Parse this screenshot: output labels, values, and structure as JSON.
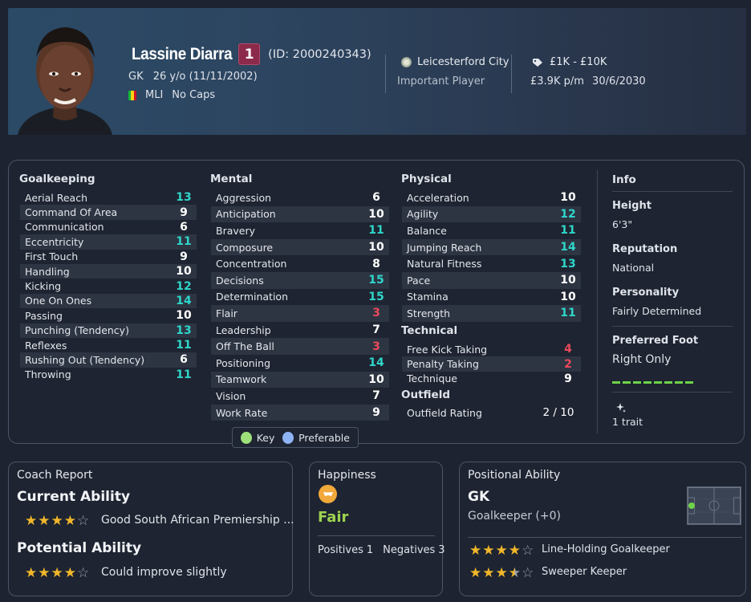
{
  "header": {
    "name": "Lassine Diarra",
    "squad_number": "1",
    "player_id": "(ID: 2000240343)",
    "position": "GK",
    "age_dob": "26 y/o (11/11/2002)",
    "nation": "MLI",
    "caps": "No Caps",
    "club": "Leicesterford City",
    "squad_role": "Important Player",
    "value": "£1K - £10K",
    "wage": "£3.9K p/m",
    "contract_end": "30/6/2030"
  },
  "sections": {
    "goalkeeping": {
      "title": "Goalkeeping",
      "attrs": [
        {
          "name": "Aerial Reach",
          "value": "13",
          "color": "cyan"
        },
        {
          "name": "Command Of Area",
          "value": "9",
          "color": "white"
        },
        {
          "name": "Communication",
          "value": "6",
          "color": "white"
        },
        {
          "name": "Eccentricity",
          "value": "11",
          "color": "cyan"
        },
        {
          "name": "First Touch",
          "value": "9",
          "color": "white"
        },
        {
          "name": "Handling",
          "value": "10",
          "color": "white"
        },
        {
          "name": "Kicking",
          "value": "12",
          "color": "cyan"
        },
        {
          "name": "One On Ones",
          "value": "14",
          "color": "cyan"
        },
        {
          "name": "Passing",
          "value": "10",
          "color": "white"
        },
        {
          "name": "Punching (Tendency)",
          "value": "13",
          "color": "cyan"
        },
        {
          "name": "Reflexes",
          "value": "11",
          "color": "cyan"
        },
        {
          "name": "Rushing Out (Tendency)",
          "value": "6",
          "color": "white"
        },
        {
          "name": "Throwing",
          "value": "11",
          "color": "cyan"
        }
      ]
    },
    "mental": {
      "title": "Mental",
      "attrs": [
        {
          "name": "Aggression",
          "value": "6",
          "color": "white"
        },
        {
          "name": "Anticipation",
          "value": "10",
          "color": "white"
        },
        {
          "name": "Bravery",
          "value": "11",
          "color": "cyan"
        },
        {
          "name": "Composure",
          "value": "10",
          "color": "white"
        },
        {
          "name": "Concentration",
          "value": "8",
          "color": "white"
        },
        {
          "name": "Decisions",
          "value": "15",
          "color": "cyan"
        },
        {
          "name": "Determination",
          "value": "15",
          "color": "cyan"
        },
        {
          "name": "Flair",
          "value": "3",
          "color": "red"
        },
        {
          "name": "Leadership",
          "value": "7",
          "color": "white"
        },
        {
          "name": "Off The Ball",
          "value": "3",
          "color": "red"
        },
        {
          "name": "Positioning",
          "value": "14",
          "color": "cyan"
        },
        {
          "name": "Teamwork",
          "value": "10",
          "color": "white"
        },
        {
          "name": "Vision",
          "value": "7",
          "color": "white"
        },
        {
          "name": "Work Rate",
          "value": "9",
          "color": "white"
        }
      ]
    },
    "physical": {
      "title": "Physical",
      "attrs": [
        {
          "name": "Acceleration",
          "value": "10",
          "color": "white"
        },
        {
          "name": "Agility",
          "value": "12",
          "color": "cyan"
        },
        {
          "name": "Balance",
          "value": "11",
          "color": "cyan"
        },
        {
          "name": "Jumping Reach",
          "value": "14",
          "color": "cyan"
        },
        {
          "name": "Natural Fitness",
          "value": "13",
          "color": "cyan"
        },
        {
          "name": "Pace",
          "value": "10",
          "color": "white"
        },
        {
          "name": "Stamina",
          "value": "10",
          "color": "white"
        },
        {
          "name": "Strength",
          "value": "11",
          "color": "cyan"
        }
      ]
    },
    "technical": {
      "title": "Technical",
      "attrs": [
        {
          "name": "Free Kick Taking",
          "value": "4",
          "color": "red"
        },
        {
          "name": "Penalty Taking",
          "value": "2",
          "color": "red"
        },
        {
          "name": "Technique",
          "value": "9",
          "color": "white"
        }
      ]
    },
    "outfield": {
      "title": "Outfield",
      "attrs": [
        {
          "name": "Outfield Rating",
          "value": "2 / 10",
          "color": "white"
        }
      ]
    }
  },
  "info": {
    "title": "Info",
    "height_label": "Height",
    "height_value": "6'3\"",
    "reputation_label": "Reputation",
    "reputation_value": "National",
    "personality_label": "Personality",
    "personality_value": "Fairly Determined",
    "foot_label": "Preferred Foot",
    "foot_value": "Right Only",
    "traits": "1 trait"
  },
  "legend": {
    "key_label": "Key",
    "key_color": "#9ee07a",
    "preferable_label": "Preferable",
    "preferable_color": "#8fb4f5"
  },
  "coach_report": {
    "title": "Coach Report",
    "current_label": "Current Ability",
    "current_stars": 4,
    "current_text": "Good South African Premiership ...",
    "potential_label": "Potential Ability",
    "potential_stars": 4,
    "potential_text": "Could improve slightly"
  },
  "happiness": {
    "title": "Happiness",
    "status": "Fair",
    "positives_label": "Positives",
    "positives": "1",
    "negatives_label": "Negatives",
    "negatives": "3"
  },
  "positional": {
    "title": "Positional Ability",
    "position": "GK",
    "role_full": "Goalkeeper (+0)",
    "roles": [
      {
        "name": "Line-Holding Goalkeeper",
        "stars": 4
      },
      {
        "name": "Sweeper Keeper",
        "stars": 3.5
      }
    ]
  },
  "colors": {
    "cyan": "#2fd5c9",
    "red": "#ea4a5a",
    "star": "#f1b72a",
    "fair": "#9ed34f"
  }
}
